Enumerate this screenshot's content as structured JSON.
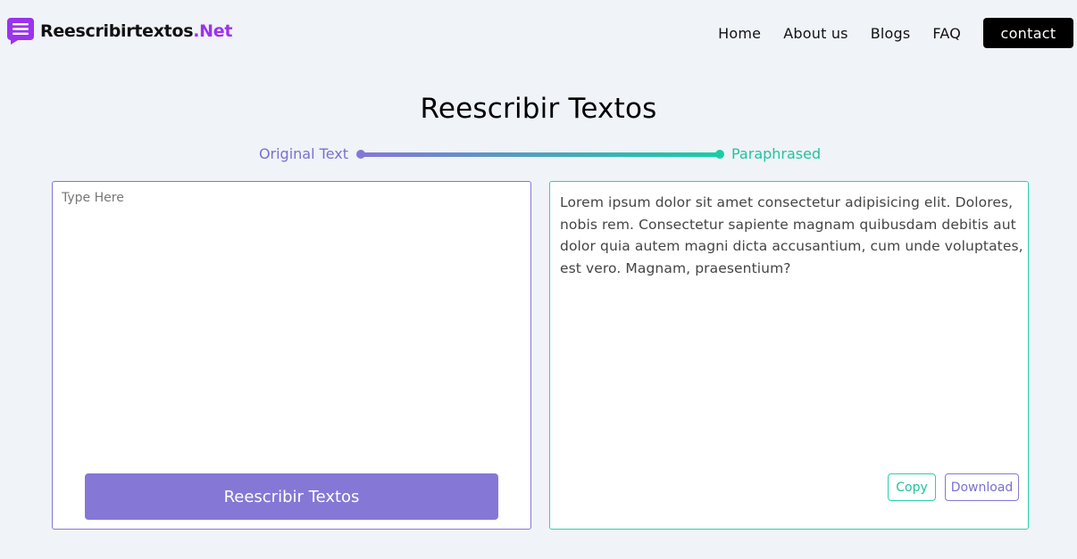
{
  "brand": {
    "name": "Reescribirtextos",
    "tld": ".Net",
    "tld_color": "#9b33ee"
  },
  "nav": {
    "items": [
      {
        "label": "Home"
      },
      {
        "label": "About us"
      },
      {
        "label": "Blogs"
      },
      {
        "label": "FAQ"
      }
    ],
    "contact_label": "contact"
  },
  "page": {
    "title": "Reescribir Textos"
  },
  "progress": {
    "start_label": "Original Text",
    "end_label": "Paraphrased"
  },
  "input_panel": {
    "value": "",
    "placeholder": "Type Here",
    "submit_label": "Reescribir Textos"
  },
  "output_panel": {
    "text": "Lorem ipsum dolor sit amet consectetur adipisicing elit. Dolores, nobis rem. Consectetur sapiente magnam quibusdam debitis aut dolor quia autem magni dicta accusantium, cum unde voluptates, est vero. Magnam, praesentium?",
    "copy_label": "Copy",
    "download_label": "Download"
  },
  "colors": {
    "accent_purple": "#8577d6",
    "accent_teal": "#18cda6",
    "background": "#f0f3f7"
  },
  "icons": {
    "logo": "chat-message-icon"
  }
}
